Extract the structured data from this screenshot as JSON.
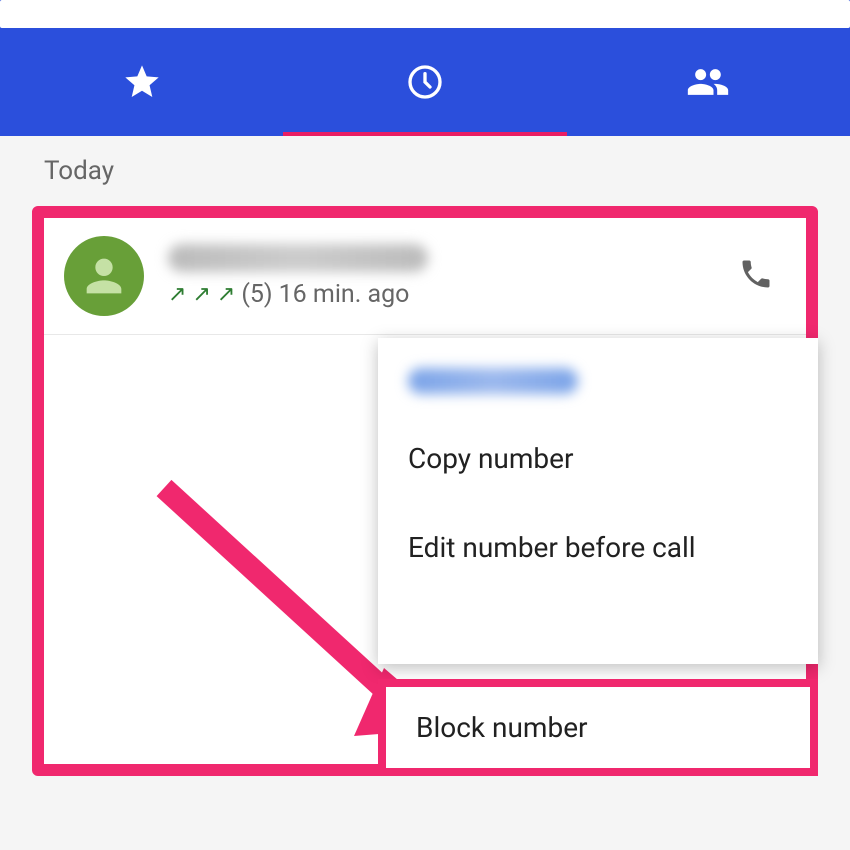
{
  "tabs": {
    "favorites": "favorites",
    "recent": "recent",
    "contacts": "contacts",
    "active_index": 1
  },
  "section": {
    "label": "Today"
  },
  "call_entry": {
    "count": "(5)",
    "time_ago": "16 min. ago",
    "direction": "outgoing"
  },
  "context_menu": {
    "items": {
      "copy": "Copy number",
      "edit": "Edit number before call",
      "block": "Block number"
    }
  },
  "colors": {
    "primary": "#2B4FDC",
    "accent": "#F0286E",
    "avatar": "#689F38"
  }
}
